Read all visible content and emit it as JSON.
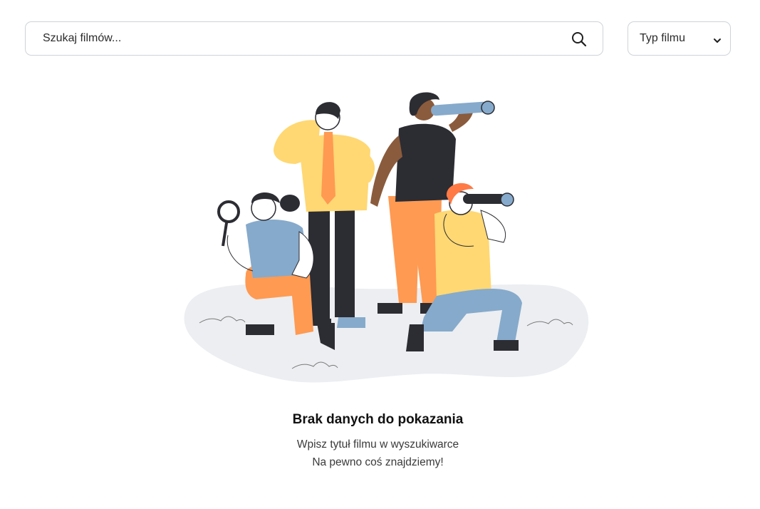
{
  "search": {
    "placeholder": "Szukaj filmów..."
  },
  "type_filter": {
    "selected": "Typ filmu"
  },
  "empty_state": {
    "title": "Brak danych do pokazania",
    "line1": "Wpisz tytuł filmu w wyszukiwarce",
    "line2": "Na pewno coś znajdziemy!"
  },
  "icons": {
    "search": "search-icon",
    "chevron": "chevron-down-icon"
  },
  "colors": {
    "border": "#cfd3d8",
    "text": "#2b2b2b",
    "orange": "#ff9a52",
    "yellow": "#ffd873",
    "blue": "#86aacb",
    "dark": "#2c2c33",
    "ground": "#eceef1"
  }
}
